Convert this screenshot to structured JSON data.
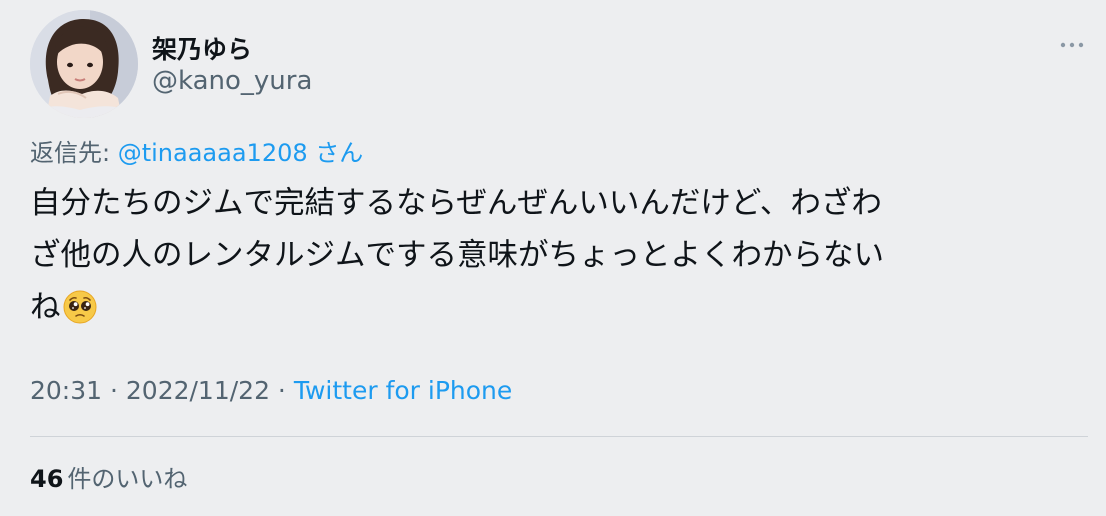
{
  "author": {
    "display_name": "架乃ゆら",
    "handle": "@kano_yura"
  },
  "reply": {
    "prefix": "返信先: ",
    "mention": "@tinaaaaa1208",
    "suffix": " さん"
  },
  "tweet": {
    "lines": [
      "自分たちのジムで完結するならぜんぜんいいんだけど、わざわ",
      "ざ他の人のレンタルジムでする意味がちょっとよくわからない",
      "ね"
    ],
    "emoji": "pleading-face-emoji"
  },
  "meta": {
    "time": "20:31",
    "separator": " · ",
    "date": "2022/11/22",
    "source": "Twitter for iPhone"
  },
  "likes": {
    "count": "46",
    "label": "件のいいね"
  },
  "icons": {
    "more": "more-dots-icon",
    "avatar": "avatar-photo"
  },
  "colors": {
    "background": "#edeef0",
    "text": "#0f1419",
    "secondary": "#536471",
    "link": "#1d9bf0"
  }
}
